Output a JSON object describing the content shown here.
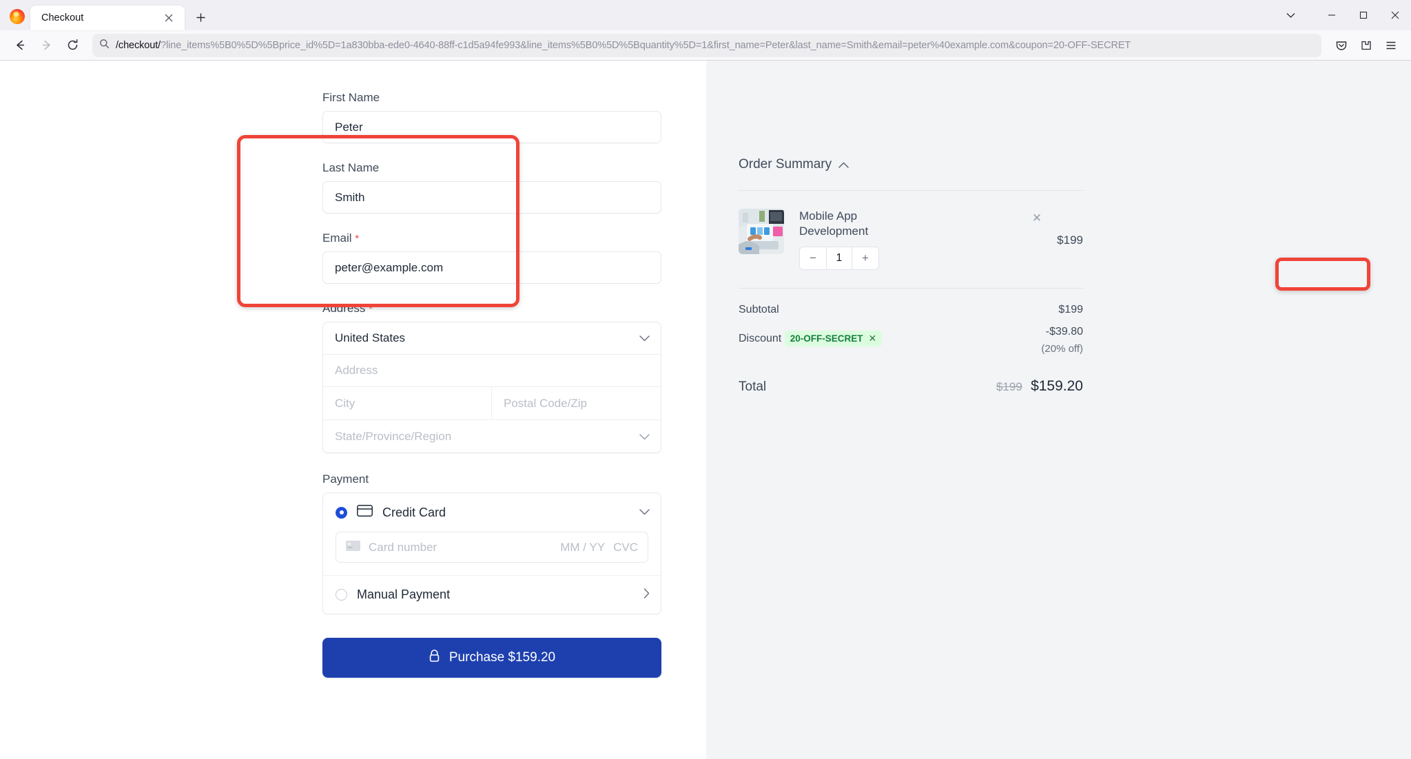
{
  "browser": {
    "tab_title": "Checkout",
    "tab_close_icon": "close-icon",
    "new_tab_icon": "plus-icon",
    "back_icon": "arrow-left-icon",
    "forward_icon": "arrow-right-icon",
    "reload_icon": "reload-icon",
    "search_icon": "search-icon",
    "url_path": "/checkout/",
    "url_query": "?line_items%5B0%5D%5Bprice_id%5D=1a830bba-ede0-4640-88ff-c1d5a94fe993&line_items%5B0%5D%5Bquantity%5D=1&first_name=Peter&last_name=Smith&email=peter%40example.com&coupon=20-OFF-SECRET",
    "window_minimize": "—",
    "window_maximize": "□",
    "window_close": "✕",
    "tab_list_chevron": "chevron-down-icon",
    "save_to_pocket_icon": "pocket-icon",
    "extensions_icon": "extensions-icon",
    "menu_icon": "hamburger-menu-icon"
  },
  "form": {
    "first_name": {
      "label": "First Name",
      "value": "Peter"
    },
    "last_name": {
      "label": "Last Name",
      "value": "Smith"
    },
    "email": {
      "label": "Email",
      "required_marker": "*",
      "value": "peter@example.com"
    },
    "address": {
      "label": "Address",
      "required_marker": "*",
      "country_value": "United States",
      "street_placeholder": "Address",
      "city_placeholder": "City",
      "postal_placeholder": "Postal Code/Zip",
      "state_placeholder": "State/Province/Region"
    },
    "payment": {
      "label": "Payment",
      "credit_card_label": "Credit Card",
      "card_number_placeholder": "Card number",
      "expiry_placeholder": "MM / YY",
      "cvc_placeholder": "CVC",
      "manual_payment_label": "Manual Payment"
    },
    "purchase_button": {
      "label": "Purchase $159.20",
      "icon": "lock-icon"
    }
  },
  "order_summary": {
    "title": "Order Summary",
    "collapse_icon": "chevron-up-icon",
    "items": [
      {
        "name": "Mobile App Development",
        "quantity": "1",
        "price": "$199",
        "decrement_label": "−",
        "increment_label": "+",
        "remove_label": "✕",
        "thumbnail": "laptop-mobile-app-photo"
      }
    ],
    "subtotal_label": "Subtotal",
    "subtotal_value": "$199",
    "discount_label": "Discount",
    "discount_value": "-$39.80",
    "coupon_code": "20-OFF-SECRET",
    "coupon_remove": "✕",
    "discount_note": "(20% off)",
    "total_label": "Total",
    "total_original": "$199",
    "total_value": "$159.20"
  },
  "colors": {
    "accent_blue": "#1e40af",
    "annotation_red": "#f04438",
    "coupon_green_bg": "#dcfce0",
    "coupon_green_text": "#15803d",
    "required_red": "#ef4444"
  }
}
